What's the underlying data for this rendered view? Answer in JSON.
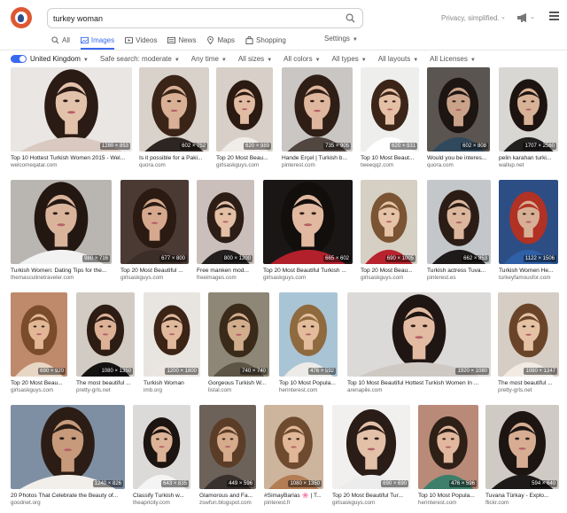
{
  "search": {
    "query": "turkey woman"
  },
  "header": {
    "privacy": "Privacy, simplified."
  },
  "tabs": [
    {
      "label": "All",
      "icon": "search-icon"
    },
    {
      "label": "Images",
      "icon": "image-icon",
      "active": true
    },
    {
      "label": "Videos",
      "icon": "play-icon"
    },
    {
      "label": "News",
      "icon": "newspaper-icon"
    },
    {
      "label": "Maps",
      "icon": "map-pin-icon"
    },
    {
      "label": "Shopping",
      "icon": "shopping-bag-icon"
    }
  ],
  "settings_label": "Settings",
  "filters": [
    {
      "label": "United Kingdom"
    },
    {
      "label": "Safe search: moderate"
    },
    {
      "label": "Any time"
    },
    {
      "label": "All sizes"
    },
    {
      "label": "All colors"
    },
    {
      "label": "All types"
    },
    {
      "label": "All layouts"
    },
    {
      "label": "All Licenses"
    }
  ],
  "colors": {
    "accent": "#3969ef",
    "logo": "#de5833"
  },
  "rows": [
    [
      {
        "title": "Top 10 Hottest Turkish Women 2015 - Wel...",
        "source": "welcomeqatar.com",
        "dims": "1280 × 853",
        "bg": "#e9e6e4",
        "hair": "#2a1b14",
        "skin": "#e3c2ab",
        "cloth": "#d9c9c0"
      },
      {
        "title": "Is it possible for a Paki...",
        "source": "quora.com",
        "dims": "602 × 752",
        "bg": "#d9d2cb",
        "hair": "#3a2418",
        "skin": "#d9b096",
        "cloth": "#2c2522"
      },
      {
        "title": "Top 20 Most Beau...",
        "source": "girlsaskguys.com",
        "dims": "620 × 989",
        "bg": "#d8d0c8",
        "hair": "#2b1a12",
        "skin": "#e1bca2",
        "cloth": "#f0ece8"
      },
      {
        "title": "Hande Erçel | Turkish b...",
        "source": "pinterest.com",
        "dims": "735 × 905",
        "bg": "#c9c6c3",
        "hair": "#2f1e16",
        "skin": "#dfb79e",
        "cloth": "#514640"
      },
      {
        "title": "Top 10 Most Beaut...",
        "source": "tweeqqz.com",
        "dims": "620 × 931",
        "bg": "#eeeeec",
        "hair": "#3b2518",
        "skin": "#e4c0a6",
        "cloth": "#ffffff"
      },
      {
        "title": "Would you be interes...",
        "source": "quora.com",
        "dims": "602 × 808",
        "bg": "#5a5550",
        "hair": "#1c1512",
        "skin": "#caa28a",
        "cloth": "#31495c"
      },
      {
        "title": "pelin karahan turki...",
        "source": "wallup.net",
        "dims": "1707 × 2560",
        "bg": "#d9d7d3",
        "hair": "#1d1411",
        "skin": "#d8b297",
        "cloth": "#232020"
      }
    ],
    [
      {
        "title": "Turkish Women: Dating Tips for the...",
        "source": "themasculinetraveler.com",
        "dims": "980 × 716",
        "bg": "#b9b5b0",
        "hair": "#231712",
        "skin": "#d9b49b",
        "cloth": "#f2f2f2"
      },
      {
        "title": "Top 20 Most Beautiful ...",
        "source": "girlsaskguys.com",
        "dims": "677 × 800",
        "bg": "#4b3a33",
        "hair": "#2a1a12",
        "skin": "#d6a98e",
        "cloth": "#3b2d27"
      },
      {
        "title": "Free manken mod...",
        "source": "freeimages.com",
        "dims": "800 × 1200",
        "bg": "#cbbfbc",
        "hair": "#2c1d16",
        "skin": "#e3bfa6",
        "cloth": "#241f1f"
      },
      {
        "title": "Top 20 Most Beautiful Turkish ...",
        "source": "girlsaskguys.com",
        "dims": "665 × 602",
        "bg": "#1b1616",
        "hair": "#120e0c",
        "skin": "#e1b9a0",
        "cloth": "#b2202c"
      },
      {
        "title": "Top 20 Most Beau...",
        "source": "girlsaskguys.com",
        "dims": "690 × 1005",
        "bg": "#d6cfc3",
        "hair": "#7a5433",
        "skin": "#e6c3a7",
        "cloth": "#b8232e"
      },
      {
        "title": "Turkish actress Tuva...",
        "source": "pinterest.es",
        "dims": "662 × 853",
        "bg": "#c4c7ca",
        "hair": "#2b1d16",
        "skin": "#dcb79e",
        "cloth": "#1e1a19"
      },
      {
        "title": "Turkish Women He...",
        "source": "turkeyfamousfor.com",
        "dims": "1122 × 1506",
        "bg": "#2c4e84",
        "hair": "#b13124",
        "skin": "#d7af94",
        "cloth": "#2f5fa6"
      }
    ],
    [
      {
        "title": "Top 20 Most Beau...",
        "source": "girlsaskguys.com",
        "dims": "690 × 920",
        "bg": "#bf8a6c",
        "hair": "#7a4b2c",
        "skin": "#e2b796",
        "cloth": "#e8d6c4"
      },
      {
        "title": "The most beautiful ...",
        "source": "pretty-grls.net",
        "dims": "1080 × 1350",
        "bg": "#d2cbc4",
        "hair": "#2c1c14",
        "skin": "#dcb196",
        "cloth": "#151212"
      },
      {
        "title": "Turkish Woman",
        "source": "imb.org",
        "dims": "1200 × 1800",
        "bg": "#e8e5e1",
        "hair": "#3b2416",
        "skin": "#e0b89c",
        "cloth": "#ece6e0"
      },
      {
        "title": "Gorgeous Turkish W...",
        "source": "listal.com",
        "dims": "740 × 740",
        "bg": "#8e8676",
        "hair": "#3a2a1a",
        "skin": "#d2ad8c",
        "cloth": "#5e5445"
      },
      {
        "title": "Top 10 Most Popula...",
        "source": "herinterest.com",
        "dims": "476 × 592",
        "bg": "#a9c4d5",
        "hair": "#8e6a3e",
        "skin": "#e3bc9c",
        "cloth": "#ecebe8"
      },
      {
        "title": "Top 10 Most Beautiful Hottest Turkish Women In ...",
        "source": "arenapile.com",
        "dims": "1920 × 1080",
        "bg": "#dcdad8",
        "hair": "#1f1613",
        "skin": "#e2bba2",
        "cloth": "#cfc9c4"
      },
      {
        "title": "The most beautiful ...",
        "source": "pretty-grls.net",
        "dims": "1080 × 1347",
        "bg": "#d6cdc5",
        "hair": "#6a4429",
        "skin": "#e6c2a5",
        "cloth": "#f1ebe4"
      }
    ],
    [
      {
        "title": "20 Photos That Celebrate the Beauty of...",
        "source": "goodnet.org",
        "dims": "1240 × 826",
        "bg": "#7f8fa3",
        "hair": "#2b1d15",
        "skin": "#c79a7b",
        "cloth": "#f2efea"
      },
      {
        "title": "Classify Turkish w...",
        "source": "theapricity.com",
        "dims": "643 × 835",
        "bg": "#dcdad9",
        "hair": "#1c1411",
        "skin": "#ddb398",
        "cloth": "#f4f4f4"
      },
      {
        "title": "Glamorous and Fa...",
        "source": "zswfun.blogspot.com",
        "dims": "449 × 596",
        "bg": "#6d6259",
        "hair": "#5b3d27",
        "skin": "#d5ab8c",
        "cloth": "#37302c"
      },
      {
        "title": "#SimayBarlas 🌸 | T...",
        "source": "pinterest.fr",
        "dims": "1080 × 1350",
        "bg": "#cdb49d",
        "hair": "#6e4a2f",
        "skin": "#e0b797",
        "cloth": "#b37d53"
      },
      {
        "title": "Top 20 Most Beautiful Tur...",
        "source": "girlsaskguys.com",
        "dims": "690 × 690",
        "bg": "#f1f0ef",
        "hair": "#2a1c16",
        "skin": "#e3c0a8",
        "cloth": "#ececec"
      },
      {
        "title": "Top 10 Most Popula...",
        "source": "herinterest.com",
        "dims": "476 × 596",
        "bg": "#b98a78",
        "hair": "#2e1f17",
        "skin": "#e1b89d",
        "cloth": "#3e7f6b"
      },
      {
        "title": "Tuvana Türkay - Explo...",
        "source": "flickr.com",
        "dims": "594 × 640",
        "bg": "#cfcac4",
        "hair": "#1c1512",
        "skin": "#d6ad93",
        "cloth": "#1d1a19"
      }
    ]
  ]
}
